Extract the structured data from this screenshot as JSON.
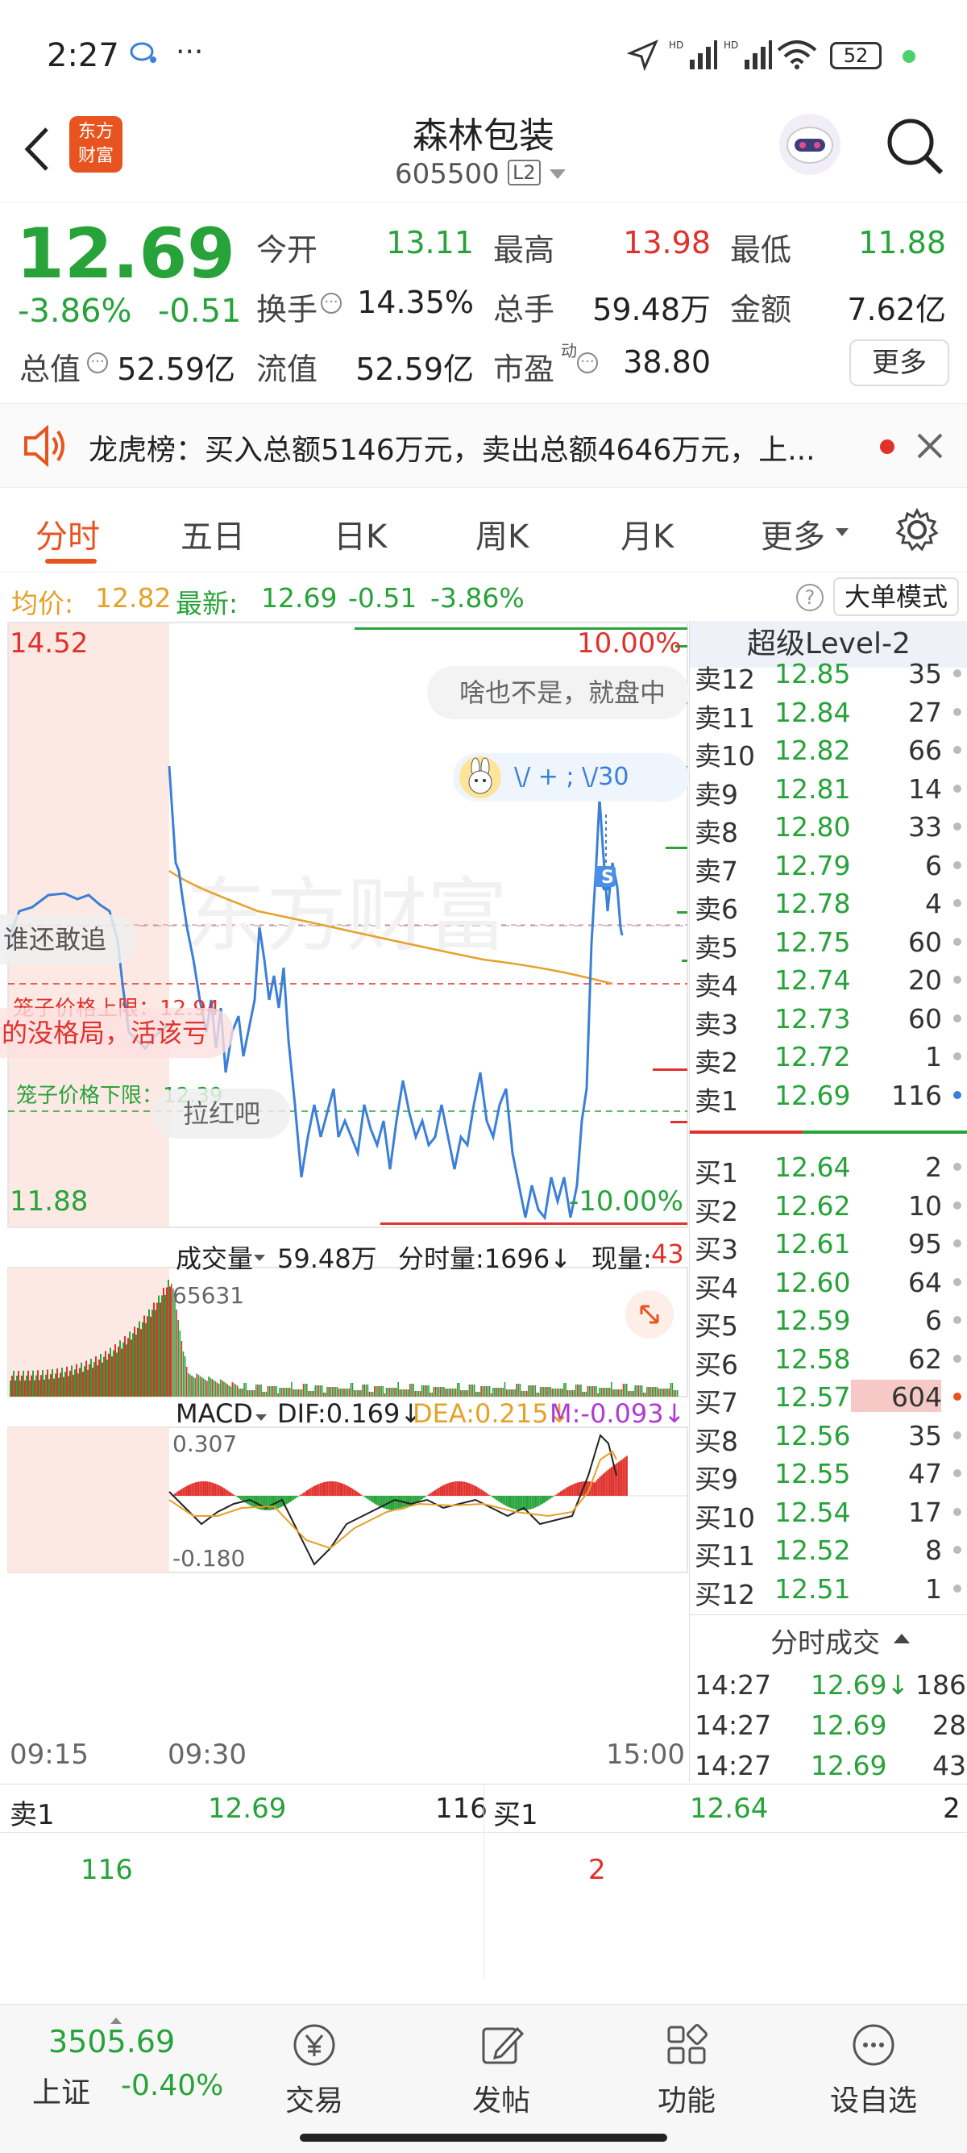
{
  "status_bar": {
    "time": "2:27",
    "dots": "···",
    "battery": "52"
  },
  "header": {
    "logo_line1": "东方",
    "logo_line2": "财富",
    "stock_name": "森林包装",
    "stock_code": "605500",
    "level_badge": "L2"
  },
  "quote": {
    "price": "12.69",
    "change_pct": "-3.86%",
    "change": "-0.51",
    "open_label": "今开",
    "open": "13.11",
    "high_label": "最高",
    "high": "13.98",
    "low_label": "最低",
    "low": "11.88",
    "turnover_label": "换手",
    "turnover": "14.35%",
    "volume_label": "总手",
    "volume": "59.48万",
    "amount_label": "金额",
    "amount": "7.62亿",
    "mcap_label": "总值",
    "mcap": "52.59亿",
    "float_label": "流值",
    "float": "52.59亿",
    "pe_label": "市盈",
    "pe_sup": "动",
    "pe": "38.80",
    "more": "更多"
  },
  "notice": {
    "text": "龙虎榜：买入总额5146万元，卖出总额4646万元，上..."
  },
  "tabs": [
    {
      "label": "分时"
    },
    {
      "label": "五日"
    },
    {
      "label": "日K"
    },
    {
      "label": "周K"
    },
    {
      "label": "月K"
    },
    {
      "label": "更多"
    }
  ],
  "infoline": {
    "avg_label": "均价:",
    "avg": "12.82",
    "latest_label": "最新:",
    "latest": "12.69",
    "chg": "-0.51",
    "pct": "-3.86%",
    "big_order": "大单模式"
  },
  "chart": {
    "y_top": "14.52",
    "y_bottom": "11.88",
    "pct_top": "10.00%",
    "pct_bottom": "-10.00%",
    "watermark": "东方财富",
    "bubble1": "啥也不是，就盘中",
    "bubble2": "\\/ + ;   \\/30",
    "upper_cage": "笼子价格上限：12.94",
    "lower_cage": "笼子价格下限：12.39",
    "overlay1": "谁还敢追",
    "overlay2": "的没格局，活该亏",
    "overlay3": "拉红吧",
    "s_marker": "S",
    "vol_label": "成交量",
    "vol_total": "59.48万",
    "vol_fen": "分时量:1696↓",
    "vol_now_label": "现量:",
    "vol_now": "43",
    "vol_max": "65631",
    "macd_label": "MACD",
    "dif": "DIF:0.169↓",
    "dea": "DEA:0.215↓",
    "m": "M:-0.093↓",
    "macd_top": "0.307",
    "macd_bottom": "-0.180",
    "time_start": "09:15",
    "time_open": "09:30",
    "time_end": "15:00"
  },
  "orderbook": {
    "title": "超级Level-2",
    "sells": [
      {
        "label": "卖12",
        "price": "12.85",
        "vol": "35"
      },
      {
        "label": "卖11",
        "price": "12.84",
        "vol": "27"
      },
      {
        "label": "卖10",
        "price": "12.82",
        "vol": "66"
      },
      {
        "label": "卖9",
        "price": "12.81",
        "vol": "14"
      },
      {
        "label": "卖8",
        "price": "12.80",
        "vol": "33"
      },
      {
        "label": "卖7",
        "price": "12.79",
        "vol": "6"
      },
      {
        "label": "卖6",
        "price": "12.78",
        "vol": "4"
      },
      {
        "label": "卖5",
        "price": "12.75",
        "vol": "60"
      },
      {
        "label": "卖4",
        "price": "12.74",
        "vol": "20"
      },
      {
        "label": "卖3",
        "price": "12.73",
        "vol": "60"
      },
      {
        "label": "卖2",
        "price": "12.72",
        "vol": "1"
      },
      {
        "label": "卖1",
        "price": "12.69",
        "vol": "116"
      }
    ],
    "buys": [
      {
        "label": "买1",
        "price": "12.64",
        "vol": "2"
      },
      {
        "label": "买2",
        "price": "12.62",
        "vol": "10"
      },
      {
        "label": "买3",
        "price": "12.61",
        "vol": "95"
      },
      {
        "label": "买4",
        "price": "12.60",
        "vol": "64"
      },
      {
        "label": "买5",
        "price": "12.59",
        "vol": "6"
      },
      {
        "label": "买6",
        "price": "12.58",
        "vol": "62"
      },
      {
        "label": "买7",
        "price": "12.57",
        "vol": "604"
      },
      {
        "label": "买8",
        "price": "12.56",
        "vol": "35"
      },
      {
        "label": "买9",
        "price": "12.55",
        "vol": "47"
      },
      {
        "label": "买10",
        "price": "12.54",
        "vol": "17"
      },
      {
        "label": "买11",
        "price": "12.52",
        "vol": "8"
      },
      {
        "label": "买12",
        "price": "12.51",
        "vol": "1"
      }
    ],
    "trades_title": "分时成交",
    "trades": [
      {
        "time": "14:27",
        "price": "12.69↓",
        "vol": "186"
      },
      {
        "time": "14:27",
        "price": "12.69",
        "vol": "28"
      },
      {
        "time": "14:27",
        "price": "12.69",
        "vol": "43"
      }
    ]
  },
  "bottom_quote": {
    "sell_label": "卖1",
    "sell_price": "12.69",
    "sell_vol": "116",
    "buy_label": "买1",
    "buy_price": "12.64",
    "buy_vol": "2",
    "sell_qty": "116",
    "buy_qty": "2"
  },
  "bottom_nav": {
    "index_value": "3505.69",
    "index_name": "上证",
    "index_change": "-0.40%",
    "items": [
      {
        "label": "交易"
      },
      {
        "label": "发帖"
      },
      {
        "label": "功能"
      },
      {
        "label": "设自选"
      }
    ]
  },
  "colors": {
    "up": "#e0312c",
    "down": "#27a33a",
    "accent": "#e8541f",
    "price_line": "#3b7fd9",
    "avg_line": "#e5a12a"
  }
}
